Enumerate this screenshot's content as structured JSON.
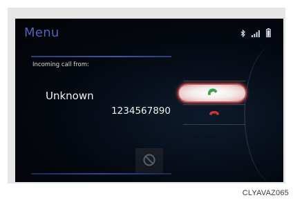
{
  "screen": {
    "menu_title": "Menu",
    "status_icons": [
      "bluetooth-icon",
      "signal-icon",
      "battery-icon"
    ]
  },
  "call": {
    "incoming_label": "Incoming call from:",
    "caller_name": "Unknown",
    "caller_number": "1234567890"
  },
  "controls": {
    "accept_icon": "phone-accept-icon",
    "decline_icon": "phone-decline-icon",
    "mute_icon": "prohibited-icon"
  },
  "colors": {
    "menu_title": "#4f63b8",
    "accept_icon": "#3da34a",
    "decline_icon": "#d6332b",
    "highlight_glow": "#e65050"
  },
  "caption": "CLYAVAZ065"
}
